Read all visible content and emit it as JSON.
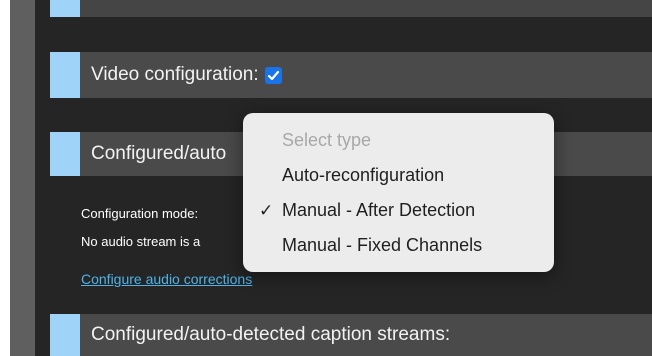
{
  "sections": {
    "video": {
      "label": "Video configuration:"
    },
    "audio": {
      "label": "Configured/auto"
    },
    "caption": {
      "label": "Configured/auto-detected caption streams:"
    }
  },
  "audio_body": {
    "mode_label": "Configuration mode:",
    "no_audio_text": "No audio stream is a",
    "configure_link": "Configure audio corrections"
  },
  "dropdown": {
    "placeholder": "Select type",
    "options": [
      {
        "label": "Auto-reconfiguration",
        "selected": false
      },
      {
        "label": "Manual - After Detection",
        "selected": true
      },
      {
        "label": "Manual - Fixed Channels",
        "selected": false
      }
    ],
    "check_symbol": "✓"
  },
  "colors": {
    "accent": "#9fd3f7",
    "background": "#252525",
    "header": "#4a4a4a",
    "link": "#4fb3e8",
    "checkbox": "#1a73e8"
  }
}
